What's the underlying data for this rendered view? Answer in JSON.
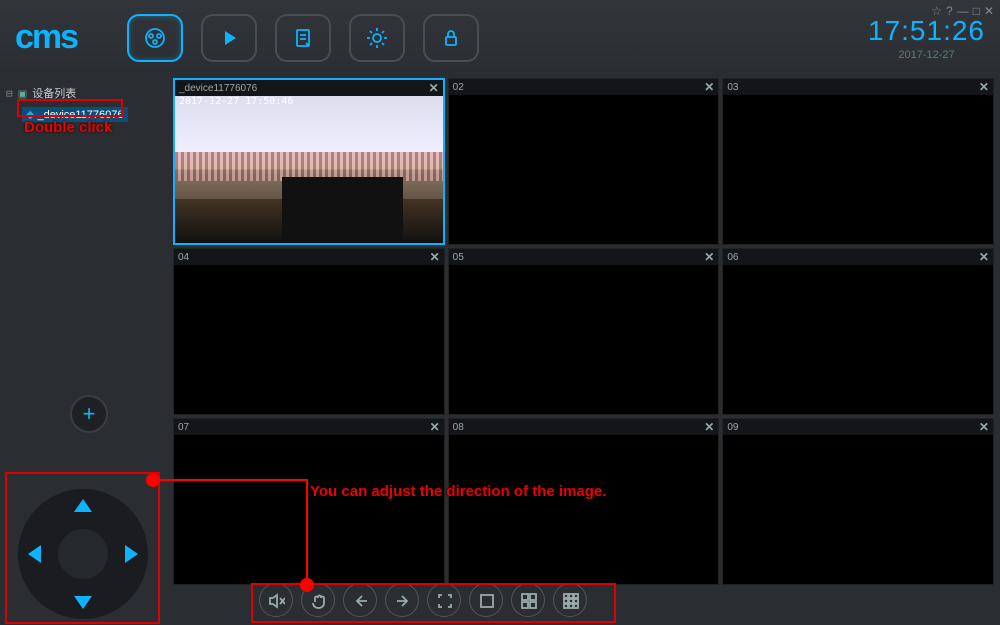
{
  "brand": "cms",
  "clock": {
    "time": "17:51:26",
    "date": "2017-12-27"
  },
  "window_controls": {
    "fav": "☆",
    "help": "?",
    "min": "—",
    "max": "□",
    "close": "✕"
  },
  "tree": {
    "root_label": "设备列表",
    "device_label": "_device11776076"
  },
  "cells": [
    {
      "title": "_device11776076",
      "close": "✕",
      "active": true,
      "overlay": "2017-12-27 17:50:46",
      "has_feed": true
    },
    {
      "title": "02",
      "close": "✕"
    },
    {
      "title": "03",
      "close": "✕"
    },
    {
      "title": "04",
      "close": "✕"
    },
    {
      "title": "05",
      "close": "✕"
    },
    {
      "title": "06",
      "close": "✕"
    },
    {
      "title": "07",
      "close": "✕"
    },
    {
      "title": "08",
      "close": "✕"
    },
    {
      "title": "09",
      "close": "✕"
    }
  ],
  "add_label": "+",
  "annotations": {
    "double_click": "Double click",
    "direction_hint": "You can adjust the direction of the image."
  },
  "colors": {
    "accent": "#0eb3ff",
    "annotation": "#e00000"
  }
}
